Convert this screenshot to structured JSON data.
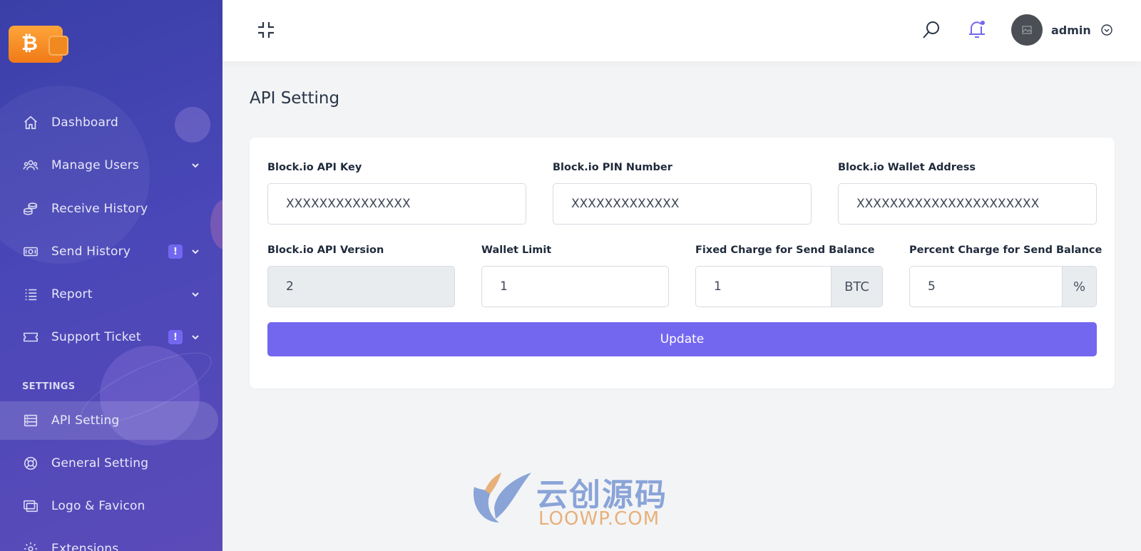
{
  "sidebar": {
    "items": [
      {
        "label": "Dashboard",
        "icon": "home-icon"
      },
      {
        "label": "Manage Users",
        "icon": "users-icon"
      },
      {
        "label": "Receive History",
        "icon": "coins-icon"
      },
      {
        "label": "Send History",
        "icon": "money-icon"
      },
      {
        "label": "Report",
        "icon": "list-icon"
      },
      {
        "label": "Support Ticket",
        "icon": "ticket-icon"
      }
    ],
    "section_label": "SETTINGS",
    "settings_items": [
      {
        "label": "API Setting",
        "icon": "server-icon"
      },
      {
        "label": "General Setting",
        "icon": "lifebuoy-icon"
      },
      {
        "label": "Logo & Favicon",
        "icon": "images-icon"
      },
      {
        "label": "Extensions",
        "icon": "gear-icon"
      }
    ],
    "badge": "!",
    "logo_symbol": "₿"
  },
  "topbar": {
    "user_name": "admin"
  },
  "page": {
    "title": "API Setting"
  },
  "form": {
    "api_key": {
      "label": "Block.io API Key",
      "value": "XXXXXXXXXXXXXXX"
    },
    "pin": {
      "label": "Block.io PIN Number",
      "value": "XXXXXXXXXXXXX"
    },
    "wallet_address": {
      "label": "Block.io Wallet Address",
      "value": "XXXXXXXXXXXXXXXXXXXXXX"
    },
    "api_version": {
      "label": "Block.io API Version",
      "value": "2"
    },
    "wallet_limit": {
      "label": "Wallet Limit",
      "value": "1"
    },
    "fixed_charge": {
      "label": "Fixed Charge for Send Balance",
      "value": "1",
      "addon": "BTC"
    },
    "percent_charge": {
      "label": "Percent Charge for Send Balance",
      "value": "5",
      "addon": "%"
    },
    "submit_label": "Update"
  },
  "watermark": {
    "cn": "云创源码",
    "en": "LOOWP.COM"
  },
  "colors": {
    "accent": "#7367f0",
    "sidebar_start": "#3a3fa8",
    "sidebar_end": "#5b4bb9",
    "logo_orange": "#f07a18"
  }
}
